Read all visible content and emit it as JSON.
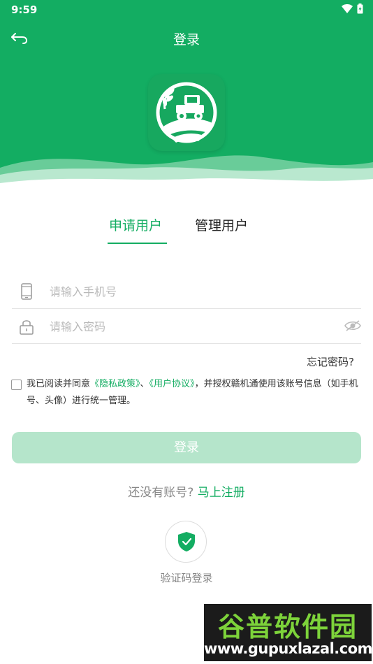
{
  "status_bar": {
    "time": "9:59"
  },
  "header": {
    "title": "登录",
    "back_icon": "back-arrow-icon"
  },
  "tabs": [
    {
      "label": "申请用户",
      "active": true
    },
    {
      "label": "管理用户",
      "active": false
    }
  ],
  "form": {
    "phone_placeholder": "请输入手机号",
    "password_placeholder": "请输入密码",
    "forgot_password": "忘记密码?"
  },
  "agreement": {
    "prefix": "我已阅读并同意",
    "privacy_link": "《隐私政策》",
    "separator": "、",
    "user_agreement_link": "《用户协议》",
    "suffix": "，并授权赣机通使用该账号信息（如手机号、头像）进行统一管理。",
    "checked": false
  },
  "login_button": "登录",
  "register": {
    "question": "还没有账号?",
    "link": "马上注册"
  },
  "sms_login": {
    "label": "验证码登录",
    "icon": "shield-check-icon"
  },
  "watermark": {
    "title": "谷普软件园",
    "url": "www.gupuxlazal.com"
  },
  "colors": {
    "primary": "#13ad62",
    "button_disabled": "#b5e5cb",
    "placeholder": "#b9b9b9"
  }
}
